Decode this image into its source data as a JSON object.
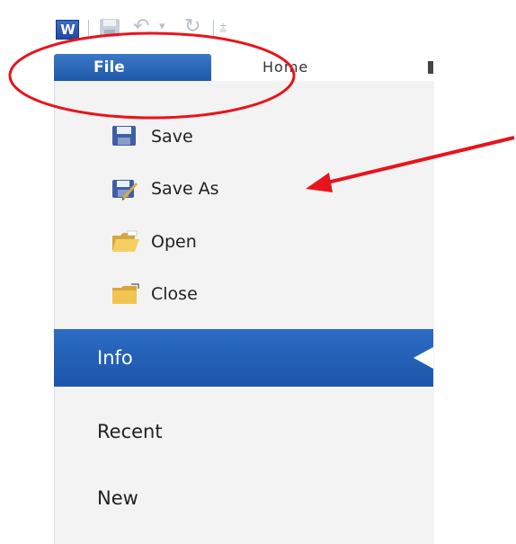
{
  "quick_access": {
    "items": [
      "word-logo-icon",
      "save-icon",
      "undo-icon",
      "redo-icon",
      "customize-icon"
    ],
    "word_logo_text": "W"
  },
  "ribbon": {
    "file_tab": "File",
    "home_tab": "Home"
  },
  "backstage": {
    "commands": [
      {
        "label": "Save",
        "icon": "save-icon"
      },
      {
        "label": "Save As",
        "icon": "save-as-icon"
      },
      {
        "label": "Open",
        "icon": "open-folder-icon"
      },
      {
        "label": "Close",
        "icon": "close-folder-icon"
      }
    ],
    "selected": "Info",
    "more": [
      "Recent",
      "New"
    ]
  },
  "colors": {
    "accent": "#1f5aaa",
    "annotation": "#e8141c"
  }
}
